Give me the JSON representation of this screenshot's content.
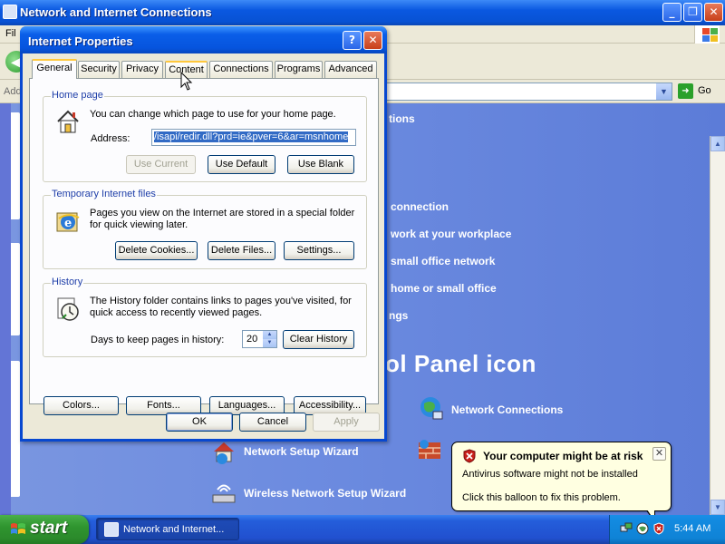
{
  "background_window": {
    "title": "Network and Internet Connections",
    "menu_first": "Fil",
    "address_label": "Add",
    "go_label": "Go",
    "task_fragments": [
      "tions",
      "connection",
      "work at your workplace",
      "small office network",
      "home or small office",
      "ngs"
    ],
    "control_panel_hint": "ol Panel icon",
    "cp_links": [
      "Network Connections",
      "Network Setup Wizard",
      "Wireless Network Setup Wizard"
    ]
  },
  "dialog": {
    "title": "Internet Properties",
    "tabs": [
      "General",
      "Security",
      "Privacy",
      "Content",
      "Connections",
      "Programs",
      "Advanced"
    ],
    "active_tab": "General",
    "home_page": {
      "legend": "Home page",
      "description": "You can change which page to use for your home page.",
      "address_label": "Address:",
      "address_value": "/isapi/redir.dll?prd=ie&pver=6&ar=msnhome",
      "use_current": "Use Current",
      "use_default": "Use Default",
      "use_blank": "Use Blank"
    },
    "temp_files": {
      "legend": "Temporary Internet files",
      "description": "Pages you view on the Internet are stored in a special folder for quick viewing later.",
      "delete_cookies": "Delete Cookies...",
      "delete_files": "Delete Files...",
      "settings": "Settings..."
    },
    "history": {
      "legend": "History",
      "description": "The History folder contains links to pages you've visited, for quick access to recently viewed pages.",
      "days_label": "Days to keep pages in history:",
      "days_value": "20",
      "clear_history": "Clear History"
    },
    "bottom_buttons": {
      "colors": "Colors...",
      "fonts": "Fonts...",
      "languages": "Languages...",
      "accessibility": "Accessibility..."
    },
    "ok": "OK",
    "cancel": "Cancel",
    "apply": "Apply"
  },
  "balloon": {
    "title": "Your computer might be at risk",
    "line1": "Antivirus software might not be installed",
    "line2": "Click this balloon to fix this problem."
  },
  "taskbar": {
    "start_label": "start",
    "task_item": "Network and Internet...",
    "clock": "5:44 AM"
  },
  "colors": {
    "title_blue": "#0a5ee8",
    "dialog_face": "#ece9d8",
    "start_green": "#2f952f",
    "taskbar_blue": "#245edb",
    "balloon_yellow": "#ffffe1",
    "alert_red": "#c8201a"
  }
}
